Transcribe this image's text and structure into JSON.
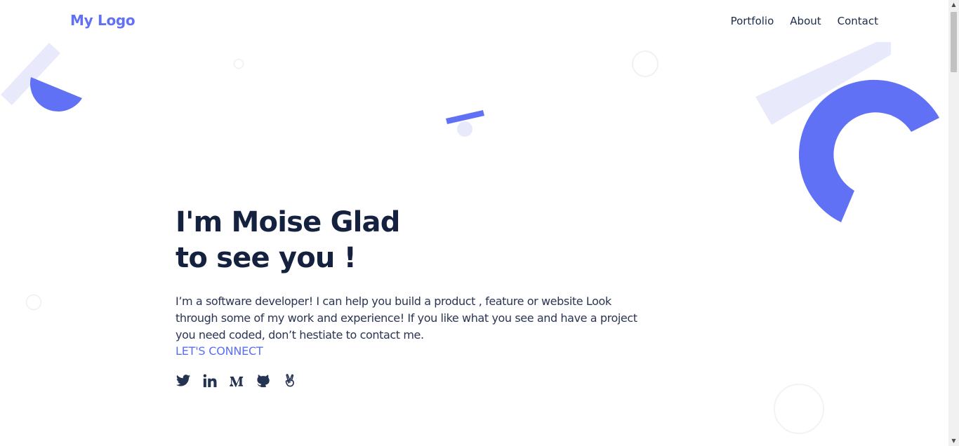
{
  "header": {
    "logo": "My Logo",
    "nav": [
      "Portfolio",
      "About",
      "Contact"
    ]
  },
  "hero": {
    "heading_line1": "I'm Moise Glad",
    "heading_line2": "to see you !",
    "description": "I’m a software developer! I can help you build a product , feature or website Look through some of my work and experience! If you like what you see and have a project you need coded, don’t hestiate to contact me.",
    "cta": "LET'S CONNECT"
  },
  "socials": [
    "twitter-icon",
    "linkedin-icon",
    "medium-icon",
    "github-icon",
    "angellist-icon"
  ],
  "colors": {
    "accent": "#6171f5",
    "accent_light": "#e8eafc",
    "heading": "#14213f",
    "text": "#2b3553"
  }
}
